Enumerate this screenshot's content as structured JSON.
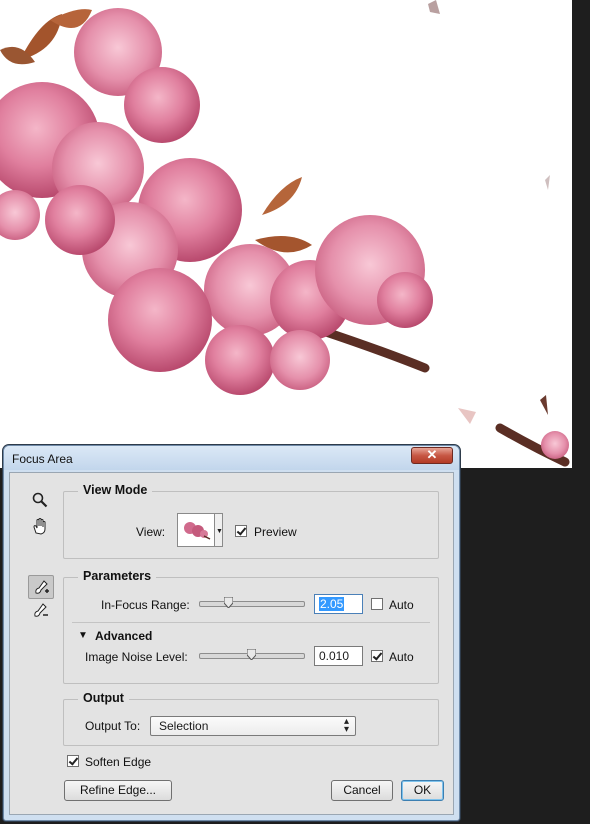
{
  "dialog": {
    "title": "Focus Area",
    "close_label": "✕"
  },
  "tools": {
    "zoom": "zoom-tool",
    "hand": "hand-tool",
    "add_brush": "focus-area-add-tool",
    "subtract_brush": "focus-area-subtract-tool"
  },
  "view_mode": {
    "title": "View Mode",
    "view_label": "View:",
    "preview_label": "Preview",
    "preview_checked": true
  },
  "parameters": {
    "title": "Parameters",
    "in_focus_label": "In-Focus Range:",
    "in_focus_value": "2.05",
    "in_focus_slider": 0.27,
    "in_focus_auto_label": "Auto",
    "in_focus_auto_checked": false,
    "advanced_label": "Advanced",
    "noise_label": "Image Noise Level:",
    "noise_value": "0.010",
    "noise_slider": 0.5,
    "noise_auto_label": "Auto",
    "noise_auto_checked": true
  },
  "output": {
    "title": "Output",
    "output_to_label": "Output To:",
    "output_to_value": "Selection"
  },
  "soften_edge": {
    "label": "Soften Edge",
    "checked": true
  },
  "buttons": {
    "refine_edge": "Refine Edge...",
    "cancel": "Cancel",
    "ok": "OK"
  }
}
